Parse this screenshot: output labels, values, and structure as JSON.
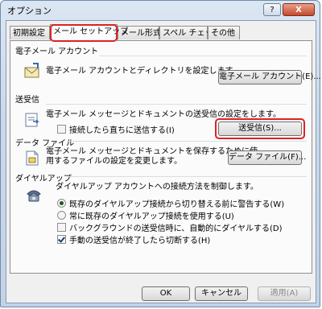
{
  "window": {
    "title": "オプション",
    "help_label": "?",
    "close_label": "X"
  },
  "tabs": [
    {
      "label": "初期設定"
    },
    {
      "label": "メール セットアップ"
    },
    {
      "label": "メール形式"
    },
    {
      "label": "スペル チェック"
    },
    {
      "label": "その他"
    }
  ],
  "groups": {
    "email_account": {
      "title": "電子メール アカウント",
      "desc": "電子メール アカウントとディレクトリを設定します。",
      "button": "電子メール アカウント(E)..."
    },
    "send_receive": {
      "title": "送受信",
      "desc": "電子メール メッセージとドキュメントの送受信の設定をします。",
      "checkbox": "接続したら直ちに送信する(I)",
      "button": "送受信(S)..."
    },
    "data_file": {
      "title": "データ ファイル",
      "desc_line1": "電子メール メッセージとドキュメントを保存するために使",
      "desc_line2": "用するファイルの設定を変更します。",
      "button": "データ ファイル(F)..."
    },
    "dialup": {
      "title": "ダイヤルアップ",
      "desc": "ダイヤルアップ アカウントへの接続方法を制御します。",
      "options": [
        {
          "type": "radio",
          "checked": true,
          "label": "既存のダイヤルアップ接続から切り替える前に警告する(W)"
        },
        {
          "type": "radio",
          "checked": false,
          "label": "常に既存のダイヤルアップ接続を使用する(U)"
        },
        {
          "type": "checkbox",
          "checked": false,
          "label": "バックグラウンドの送受信時に、自動的にダイヤルする(D)"
        },
        {
          "type": "checkbox",
          "checked": true,
          "label": "手動の送受信が終了したら切断する(H)"
        }
      ]
    }
  },
  "footer": {
    "ok": "OK",
    "cancel": "キャンセル",
    "apply": "適用(A)"
  },
  "colors": {
    "highlight_ring": "#dd2222",
    "group_line": "#d5dfe5"
  }
}
